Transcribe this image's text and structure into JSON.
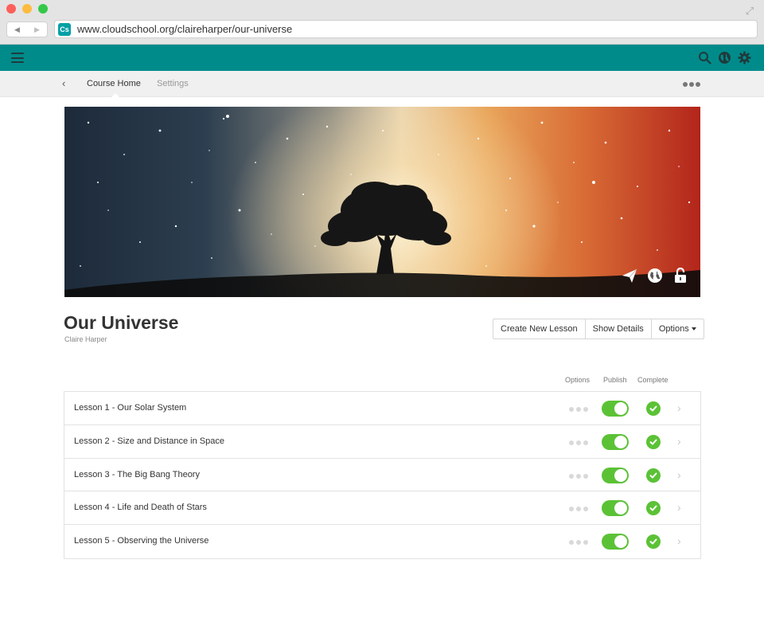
{
  "browser": {
    "url": "www.cloudschool.org/claireharper/our-universe",
    "favicon_text": "Cs",
    "back_glyph": "◀",
    "forward_glyph": "▶",
    "expand_glyph": "⤢"
  },
  "colors": {
    "topbar": "#008b8b",
    "toggle_on": "#5bc236",
    "complete": "#5bc236"
  },
  "subnav": {
    "back_glyph": "‹",
    "tabs": [
      {
        "label": "Course Home",
        "active": true
      },
      {
        "label": "Settings",
        "active": false
      }
    ]
  },
  "banner": {
    "icons": [
      "send-icon",
      "globe-icon",
      "unlock-icon"
    ]
  },
  "course": {
    "title": "Our Universe",
    "author": "Claire Harper"
  },
  "actions": {
    "create_lesson": "Create New Lesson",
    "show_details": "Show Details",
    "options": "Options"
  },
  "columns": {
    "options": "Options",
    "publish": "Publish",
    "complete": "Complete"
  },
  "lessons": [
    {
      "title": "Lesson 1 - Our Solar System",
      "published": true,
      "complete": true
    },
    {
      "title": "Lesson 2 - Size and Distance in Space",
      "published": true,
      "complete": true
    },
    {
      "title": "Lesson 3 - The Big Bang Theory",
      "published": true,
      "complete": true
    },
    {
      "title": "Lesson 4 - Life and Death of Stars",
      "published": true,
      "complete": true
    },
    {
      "title": "Lesson 5 - Observing the Universe",
      "published": true,
      "complete": true
    }
  ],
  "row_chevron": "›"
}
